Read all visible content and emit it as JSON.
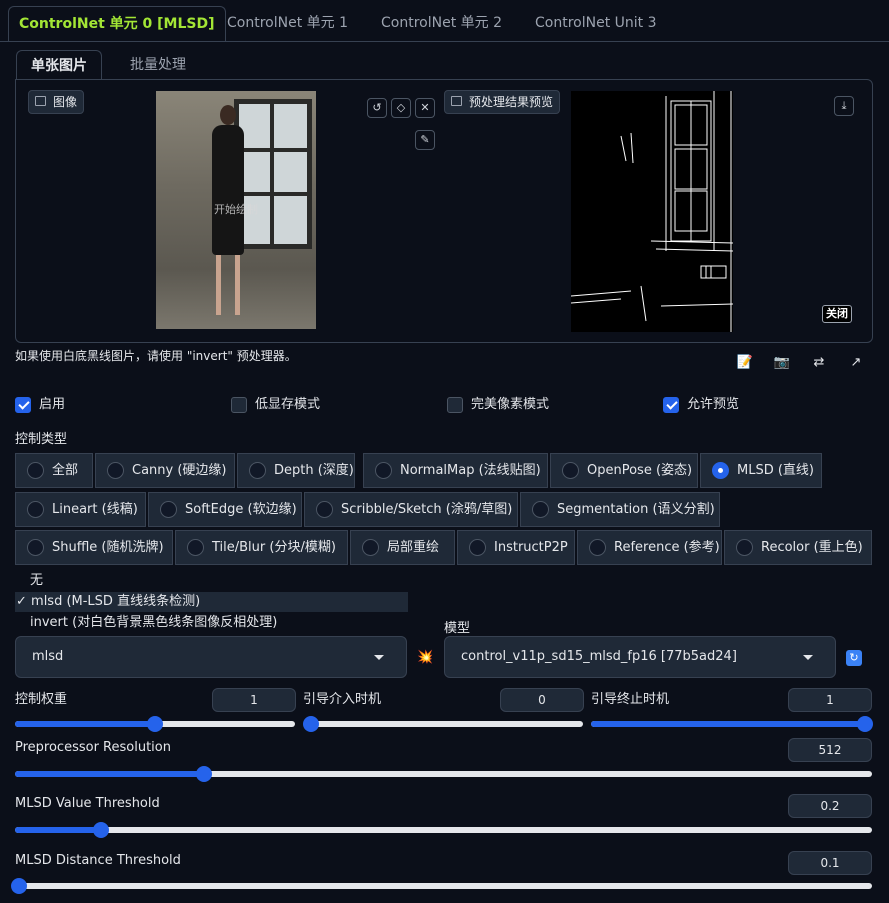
{
  "tabs": [
    "ControlNet 单元 0 [MLSD]",
    "ControlNet 单元 1",
    "ControlNet 单元 2",
    "ControlNet Unit 3"
  ],
  "subtabs": [
    "单张图片",
    "批量处理"
  ],
  "image_panel": {
    "image_label": "图像",
    "watermark": "开始绘制",
    "preview_label": "预处理结果预览",
    "close_label": "关闭",
    "reset_icon": "↺",
    "erase_icon": "◇",
    "clear_icon": "✕",
    "brush_icon": "✎",
    "download_icon": "⤓"
  },
  "hint": "如果使用白底黑线图片，请使用 \"invert\" 预处理器。",
  "toolbar_icons": [
    "📝",
    "📷",
    "⇄",
    "↗"
  ],
  "checkboxes": [
    {
      "label": "启用",
      "checked": true
    },
    {
      "label": "低显存模式",
      "checked": false
    },
    {
      "label": "完美像素模式",
      "checked": false
    },
    {
      "label": "允许预览",
      "checked": true
    }
  ],
  "control_type_label": "控制类型",
  "control_types": [
    "全部",
    "Canny (硬边缘)",
    "Depth (深度)",
    "NormalMap (法线贴图)",
    "OpenPose (姿态)",
    "MLSD (直线)",
    "Lineart (线稿)",
    "SoftEdge (软边缘)",
    "Scribble/Sketch (涂鸦/草图)",
    "Segmentation (语义分割)",
    "Shuffle (随机洗牌)",
    "Tile/Blur (分块/模糊)",
    "局部重绘",
    "InstructP2P",
    "Reference (参考)",
    "Recolor (重上色)"
  ],
  "selected_control_type": "MLSD (直线)",
  "preprocessor_options": [
    "无",
    "✓ mlsd (M-LSD 直线线条检测)",
    "invert (对白色背景黑色线条图像反相处理)"
  ],
  "preprocessor_value": "mlsd",
  "model_label": "模型",
  "model_value": "control_v11p_sd15_mlsd_fp16 [77b5ad24]",
  "boom_icon": "💥",
  "refresh_icon": "↻",
  "sliders": {
    "weight": {
      "label": "控制权重",
      "value": "1",
      "fraction": 0.5
    },
    "start": {
      "label": "引导介入时机",
      "value": "0",
      "fraction": 0.0
    },
    "end": {
      "label": "引导终止时机",
      "value": "1",
      "fraction": 1.0
    },
    "resolution": {
      "label": "Preprocessor Resolution",
      "value": "512",
      "fraction": 0.22
    },
    "value_threshold": {
      "label": "MLSD Value Threshold",
      "value": "0.2",
      "fraction": 0.1
    },
    "distance_threshold": {
      "label": "MLSD Distance Threshold",
      "value": "0.1",
      "fraction": 0.005
    }
  },
  "colors": {
    "accent": "#2563eb",
    "active_tab": "#a3e635",
    "background": "#0b0f19",
    "surface": "#1f2937"
  }
}
